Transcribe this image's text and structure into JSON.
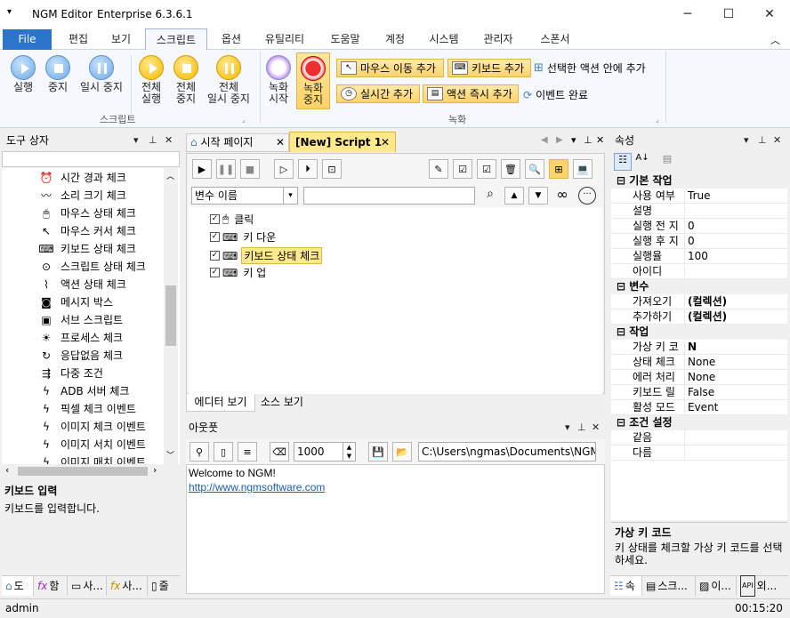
{
  "app": {
    "title_left": "NGM Editor",
    "edition": "Enterprise 6.3.6.1"
  },
  "menu": {
    "file": "File",
    "items": [
      "편집",
      "보기",
      "스크립트",
      "옵션",
      "유틸리티",
      "도움말",
      "계정",
      "시스템",
      "관리자",
      "스폰서"
    ]
  },
  "ribbon": {
    "run": "실행",
    "stop": "중지",
    "pause": "일시 중지",
    "full_run": [
      "전체",
      "실행"
    ],
    "full_stop": [
      "전체",
      "중지"
    ],
    "full_pause": [
      "전체",
      "일시 중지"
    ],
    "group_script": "스크립트",
    "rec_start": [
      "녹화",
      "시작"
    ],
    "rec_stop": [
      "녹화",
      "중지"
    ],
    "add_mouse": "마우스 이동 추가",
    "add_keyboard": "키보드 추가",
    "add_in_selected": "선택한 액션 안에 추가",
    "add_realtime": "실시간 추가",
    "add_action_now": "액션 즉시 추가",
    "event_done": "이벤트 완료",
    "group_record": "녹화"
  },
  "toolbox": {
    "title": "도구 상자",
    "items": [
      "시간 경과 체크",
      "소리 크기 체크",
      "마우스 상태 체크",
      "마우스 커서 체크",
      "키보드 상태 체크",
      "스크립트 상태 체크",
      "액션 상태 체크",
      "메시지 박스",
      "서브 스크립트",
      "프로세스 체크",
      "응답없음 체크",
      "다중 조건",
      "ADB 서버 체크",
      "픽셀 체크 이벤트",
      "이미지 체크 이벤트",
      "이미지 서치 이벤트",
      "이미지 매치 이벤트"
    ],
    "desc_title": "키보드 입력",
    "desc_text": "키보드를 입력합니다.",
    "bottom_tabs": [
      "도",
      "함",
      "사...",
      "사...",
      "줄"
    ]
  },
  "editor": {
    "tab_start": "시작 페이지",
    "tab_script": "[New] Script 1",
    "var_select": "변수 이름",
    "tree": [
      "클릭",
      "키 다운",
      "키보드 상태 체크",
      "키 업"
    ],
    "view_editor": "에디터 보기",
    "view_source": "소스 보기"
  },
  "output": {
    "title": "아웃풋",
    "count": "1000",
    "path": "C:\\Users\\ngmas\\Documents\\NGM6\\",
    "line1": "Welcome to NGM!",
    "line2": "http://www.ngmsoftware.com"
  },
  "props": {
    "title": "속성",
    "cat_basic": "기본 작업",
    "basic": [
      [
        "사용 여부",
        "True"
      ],
      [
        "설명",
        ""
      ],
      [
        "실행 전 지",
        "0"
      ],
      [
        "실행 후 지",
        "0"
      ],
      [
        "실행율",
        "100"
      ],
      [
        "아이디",
        ""
      ]
    ],
    "cat_var": "변수",
    "var": [
      [
        "가져오기",
        "(컬렉션)"
      ],
      [
        "추가하기",
        "(컬렉션)"
      ]
    ],
    "cat_job": "작업",
    "job": [
      [
        "가상 키 코",
        "N"
      ],
      [
        "상태 체크",
        "None"
      ],
      [
        "에러 처리",
        "None"
      ],
      [
        "키보드 릴",
        "False"
      ],
      [
        "활성 모드",
        "Event"
      ]
    ],
    "cat_cond": "조건 설정",
    "cond": [
      [
        "같음",
        ""
      ],
      [
        "다름",
        ""
      ]
    ],
    "desc_title": "가상 키 코드",
    "desc_text": "키 상태를 체크할 가상 키 코드를 선택하세요.",
    "bottom_tabs": [
      "속",
      "스크...",
      "이...",
      "외..."
    ]
  },
  "status": {
    "user": "admin",
    "time": "00:15:20"
  }
}
